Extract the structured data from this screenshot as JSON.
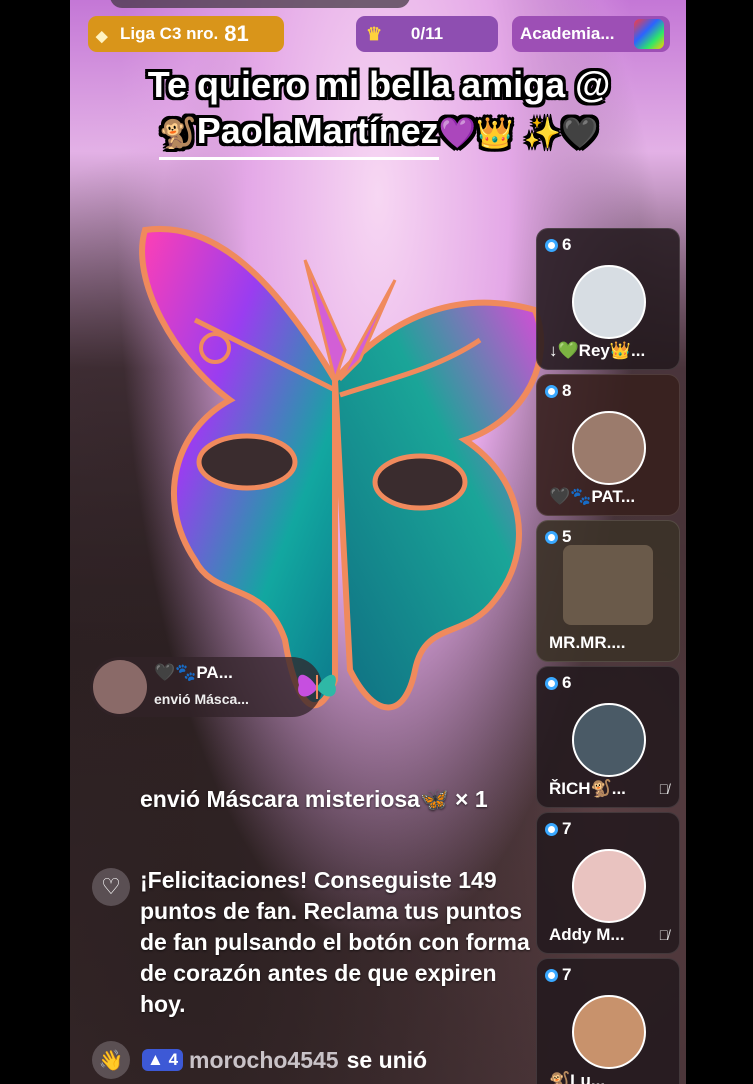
{
  "top": {
    "league_label": "Liga C3 nro.",
    "league_number": "81",
    "score": "0/11",
    "academy": "Academia..."
  },
  "pinned": {
    "line1": "Te quiero mi bella amiga @",
    "line2_prefix": "🐒",
    "line2_name": "PaolaMartínez",
    "line2_emojis": "💜👑 ✨🖤"
  },
  "guests": [
    {
      "count": "6",
      "name": "↓💚Rey👑..."
    },
    {
      "count": "8",
      "name": "🖤🐾PAT..."
    },
    {
      "count": "5",
      "name": "MR.MR...."
    },
    {
      "count": "6",
      "name": "ŘICH🐒...",
      "muted": true
    },
    {
      "count": "7",
      "name": "Addy M...",
      "muted": true
    },
    {
      "count": "7",
      "name": "🐒Lu..."
    }
  ],
  "gift_notice": {
    "name": "🖤🐾PA...",
    "text": "envió Másca..."
  },
  "chat": {
    "gift_line": "envió Máscara misteriosa🦋 × 1",
    "fan_message": "¡Felicitaciones! Conseguiste 149 puntos de fan. Reclama tus puntos de fan pulsando el botón con forma de corazón antes de que expiren hoy.",
    "join_level": "4",
    "join_user": "morocho4545",
    "join_text": "se unió"
  },
  "colors": {
    "league_bg": "#d9951a",
    "score_bg": "#8e4eb1",
    "academy_bg": "#9d4fb5",
    "level_badge": "#3d59d6"
  }
}
